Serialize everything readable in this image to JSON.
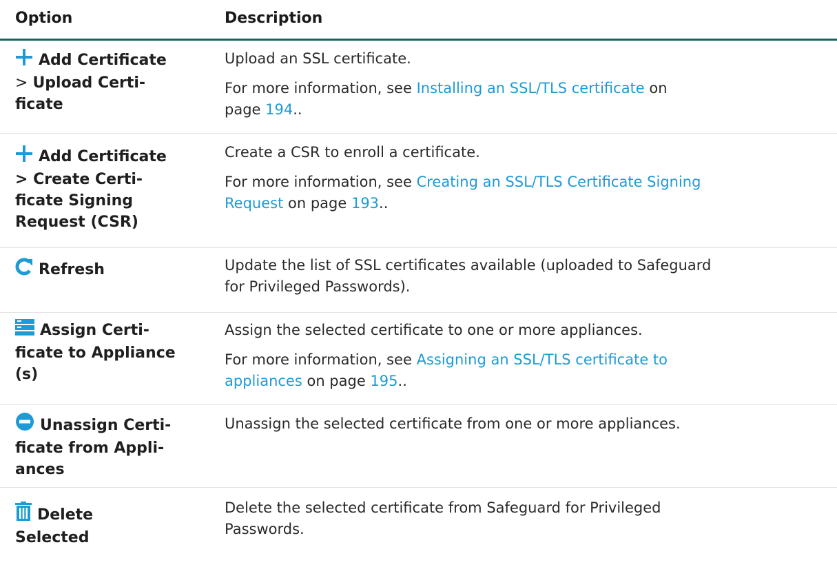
{
  "header": {
    "option": "Option",
    "description": "Description"
  },
  "rows": [
    {
      "icon": "plus-icon",
      "option_parts": [
        "Add Certificate",
        " > ",
        "Upload Certi-",
        "ficate"
      ],
      "description": "Upload an SSL certificate.",
      "more_prefix": "For more information, see ",
      "more_link": "Installing an SSL/TLS certificate",
      "more_mid": " on",
      "more_page_prefix": "page ",
      "more_page": "194",
      "more_suffix": ".."
    },
    {
      "icon": "plus-icon",
      "option_parts": [
        "Add Certificate",
        "> Create Certi-",
        "ficate Signing",
        "Request (CSR)"
      ],
      "description": "Create a CSR to enroll a certificate.",
      "more_prefix": "For more information, see ",
      "more_link_1": "Creating an SSL/TLS Certificate Signing",
      "more_link_2": "Request",
      "more_mid": " on page ",
      "more_page": "193",
      "more_suffix": ".."
    },
    {
      "icon": "refresh-icon",
      "option_parts": [
        "Refresh"
      ],
      "description_1": "Update the list of SSL certificates available (uploaded to Safeguard",
      "description_2": "for Privileged Passwords)."
    },
    {
      "icon": "server-icon",
      "option_parts": [
        "Assign Certi-",
        "ficate to Appliance",
        "(s)"
      ],
      "description": "Assign the selected certificate to one or more appliances.",
      "more_prefix": "For more information, see ",
      "more_link_1": "Assigning an SSL/TLS certificate to",
      "more_link_2": "appliances",
      "more_mid": " on page ",
      "more_page": "195",
      "more_suffix": ".."
    },
    {
      "icon": "minus-circle-icon",
      "option_parts": [
        "Unassign Certi-",
        "ficate from Appli-",
        "ances"
      ],
      "description": "Unassign the selected certificate from one or more appliances."
    },
    {
      "icon": "trash-icon",
      "option_parts": [
        "Delete",
        "Selected"
      ],
      "description_1": "Delete the selected certificate from Safeguard for Privileged",
      "description_2": "Passwords."
    }
  ],
  "colors": {
    "accent": "#1e9ad6",
    "header_rule": "#1a5f5a",
    "text": "#222222"
  }
}
